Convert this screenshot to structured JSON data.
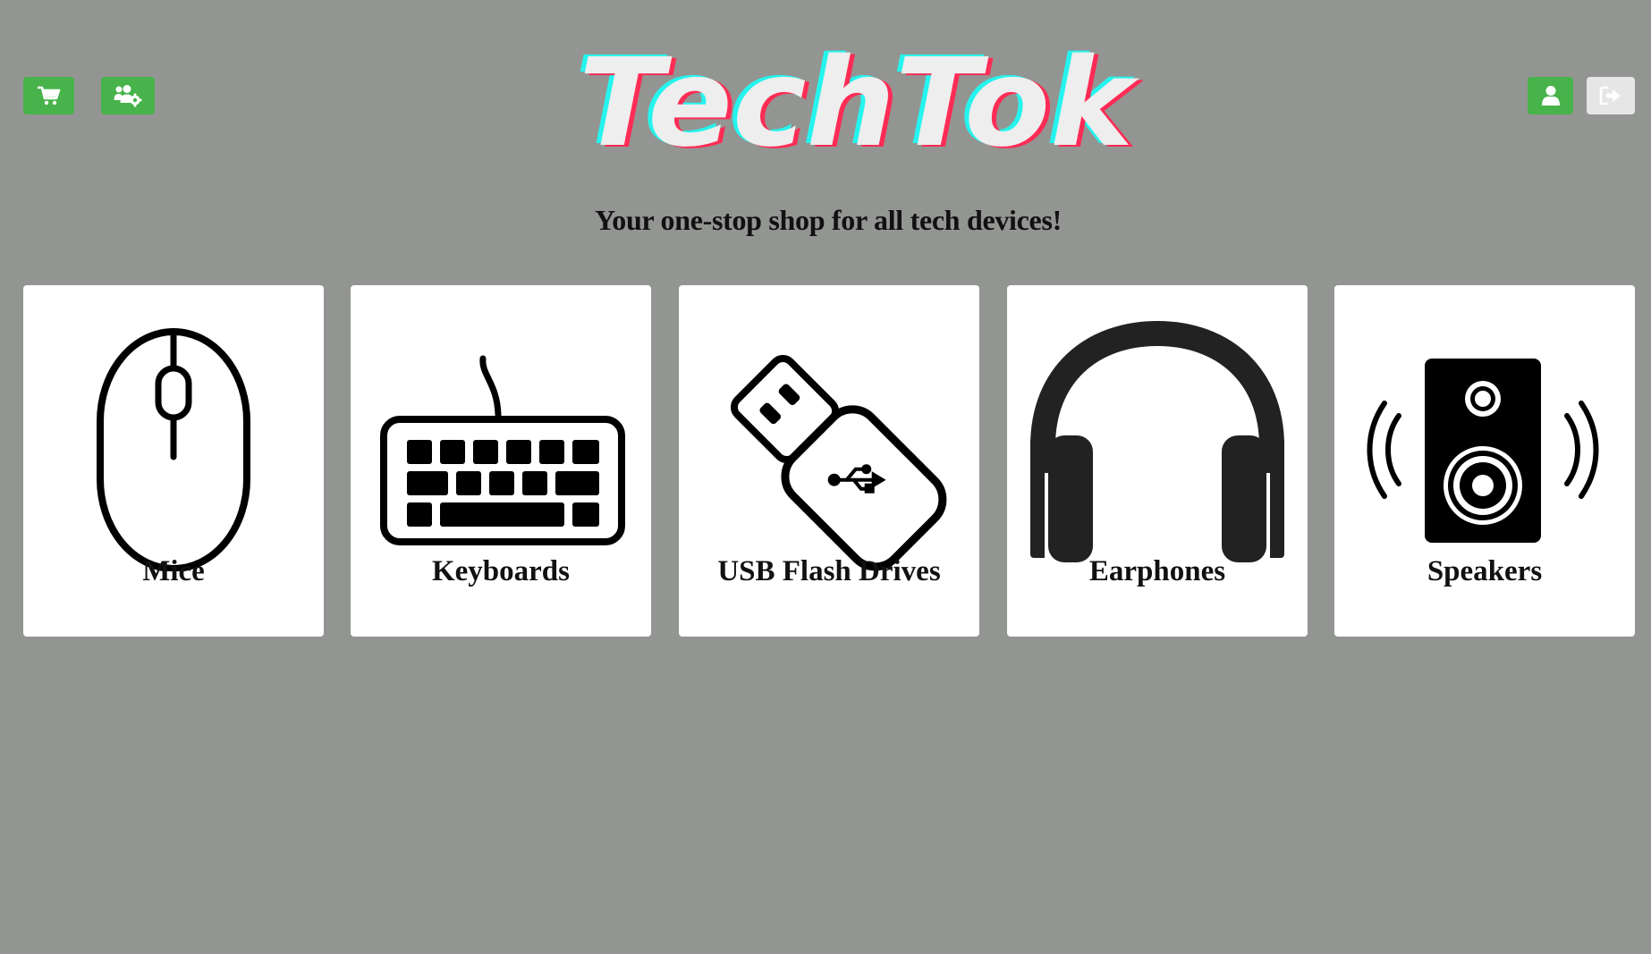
{
  "header": {
    "brand": "TechTok",
    "tagline": "Your one-stop shop for all tech devices!",
    "left_buttons": [
      {
        "icon": "shopping-cart-icon",
        "color": "#47b34a"
      },
      {
        "icon": "users-cog-icon",
        "color": "#47b34a"
      }
    ],
    "right_buttons": [
      {
        "icon": "user-icon",
        "color": "#47b34a"
      },
      {
        "icon": "sign-out-icon",
        "color": "#e6e6e6"
      }
    ]
  },
  "categories": [
    {
      "label": "Mice",
      "icon": "mouse-icon"
    },
    {
      "label": "Keyboards",
      "icon": "keyboard-icon"
    },
    {
      "label": "USB Flash Drives",
      "icon": "usb-flash-drive-icon"
    },
    {
      "label": "Earphones",
      "icon": "headphones-icon"
    },
    {
      "label": "Speakers",
      "icon": "speaker-icon"
    }
  ],
  "colors": {
    "background": "#939592",
    "accent": "#47b34a",
    "logo_fill": "#eeeeee",
    "logo_cyan": "#25f4ee",
    "logo_pink": "#fe2c55"
  }
}
